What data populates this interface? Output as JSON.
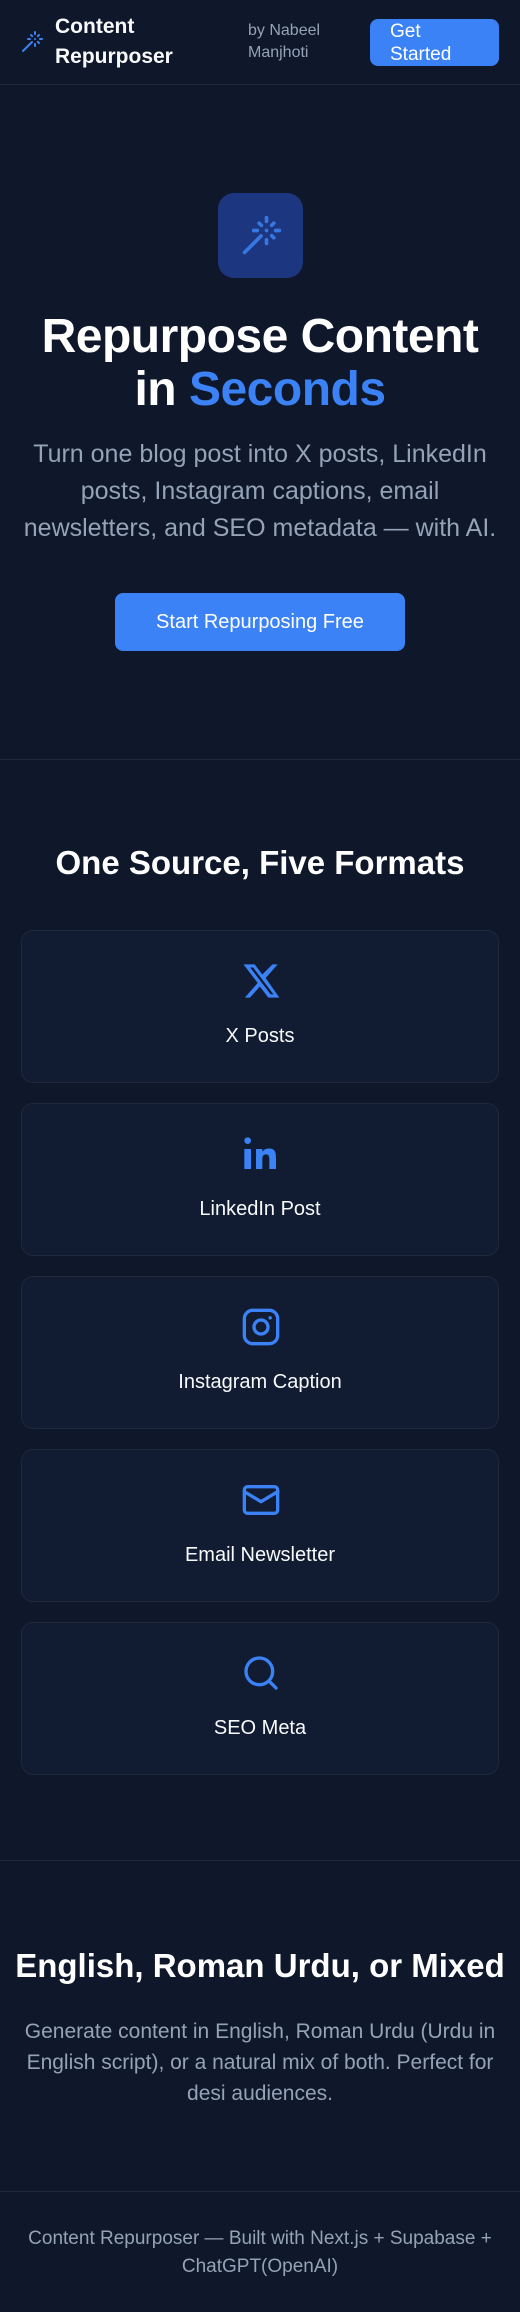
{
  "header": {
    "app_name": "Content Repurposer",
    "byline": "by Nabeel Manjhoti",
    "cta_label": "Get Started",
    "logo_icon": "magic-wand-icon"
  },
  "hero": {
    "icon": "magic-wand-icon",
    "title_line1": "Repurpose Content",
    "title_in": "in ",
    "title_accent": "Seconds",
    "subtitle": "Turn one blog post into X posts, LinkedIn posts, Instagram captions, email newsletters, and SEO metadata — with AI.",
    "cta_label": "Start Repurposing Free"
  },
  "formats": {
    "title": "One Source, Five Formats",
    "items": [
      {
        "label": "X Posts",
        "icon": "x-logo-icon"
      },
      {
        "label": "LinkedIn Post",
        "icon": "linkedin-icon"
      },
      {
        "label": "Instagram Caption",
        "icon": "instagram-icon"
      },
      {
        "label": "Email Newsletter",
        "icon": "mail-icon"
      },
      {
        "label": "SEO Meta",
        "icon": "search-icon"
      }
    ]
  },
  "languages": {
    "title": "English, Roman Urdu, or Mixed",
    "subtitle": "Generate content in English, Roman Urdu (Urdu in English script), or a natural mix of both. Perfect for desi audiences."
  },
  "footer": {
    "text": "Content Repurposer — Built with Next.js + Supabase + ChatGPT(OpenAI)"
  },
  "colors": {
    "background": "#0f172a",
    "card": "#111c32",
    "accent": "#3b82f6",
    "muted_text": "#94a3b8"
  }
}
